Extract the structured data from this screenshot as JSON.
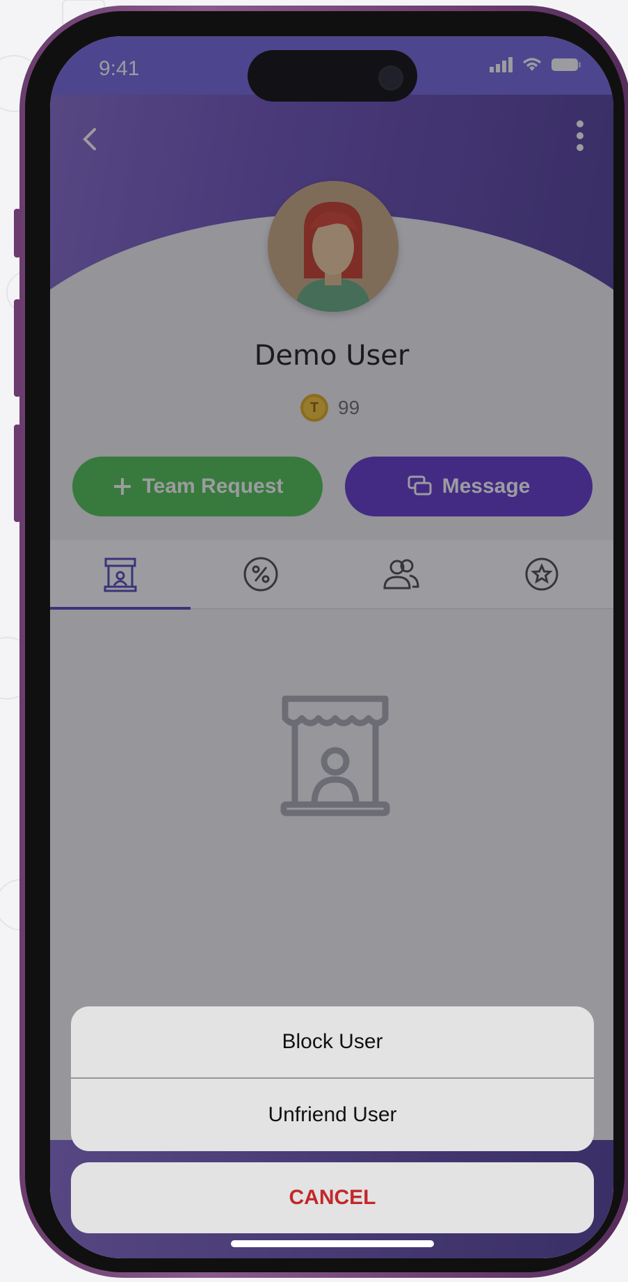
{
  "status_bar": {
    "time": "9:41"
  },
  "profile": {
    "name": "Demo User",
    "coins": "99",
    "coin_letter": "T"
  },
  "actions": {
    "team_request_label": "Team Request",
    "message_label": "Message"
  },
  "tabs": [
    {
      "icon": "store-icon",
      "active": true
    },
    {
      "icon": "percent-icon",
      "active": false
    },
    {
      "icon": "friends-icon",
      "active": false
    },
    {
      "icon": "star-badge-icon",
      "active": false
    }
  ],
  "action_sheet": {
    "options": [
      "Block User",
      "Unfriend User"
    ],
    "cancel_label": "CANCEL"
  },
  "colors": {
    "accent": "#6e5fdc",
    "team_button": "#46c149",
    "message_button": "#5b2fc9",
    "cancel_text": "#c2282b"
  }
}
